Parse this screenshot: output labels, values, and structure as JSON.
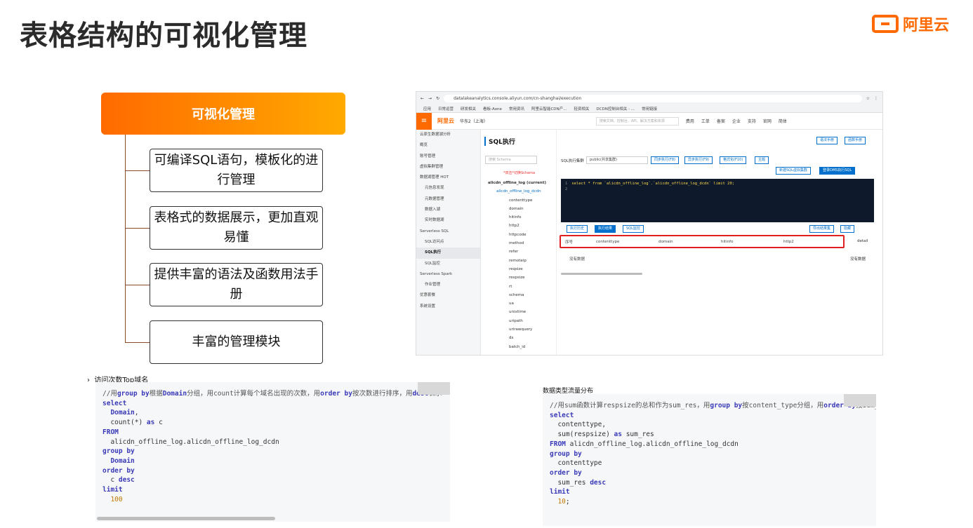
{
  "title": "表格结构的可视化管理",
  "logo_text": "阿里云",
  "mindmap": {
    "root": "可视化管理",
    "items": [
      "可编译SQL语句，模板化的进行管理",
      "表格式的数据展示，更加直观易懂",
      "提供丰富的语法及函数用法手册",
      "丰富的管理模块"
    ]
  },
  "console": {
    "url": "datalakeanalytics.console.aliyun.com/cn-shanghai/execution",
    "bookmarks": [
      "应用",
      "日常运营",
      "研发相关",
      "看板-Aone",
      "常用资讯",
      "阿里云智能CDN产...",
      "轻资相关",
      "DCDN控制台相关 - ...",
      "常用链接"
    ],
    "brand": "阿里云",
    "region": "华东2（上海）",
    "search_placeholder": "搜索文档、控制台、API、解决方案和资源",
    "nav_links": [
      "费用",
      "工单",
      "备案",
      "企业",
      "支持",
      "官网",
      "简体"
    ],
    "sidebar": [
      {
        "label": "云原生数据湖分析",
        "sub": false,
        "active": false
      },
      {
        "label": "概览",
        "sub": false,
        "active": false
      },
      {
        "label": "账号管理",
        "sub": false,
        "active": false
      },
      {
        "label": "虚拟集群管理",
        "sub": false,
        "active": false
      },
      {
        "label": "数据湖管理  HOT",
        "sub": false,
        "active": false
      },
      {
        "label": "元信息发现",
        "sub": true,
        "active": false
      },
      {
        "label": "元数据管理",
        "sub": true,
        "active": false
      },
      {
        "label": "数据入湖",
        "sub": true,
        "active": false
      },
      {
        "label": "实时数据湖",
        "sub": true,
        "active": false
      },
      {
        "label": "Serverless SQL",
        "sub": false,
        "active": false
      },
      {
        "label": "SQL访问点",
        "sub": true,
        "active": false
      },
      {
        "label": "SQL执行",
        "sub": true,
        "active": true
      },
      {
        "label": "SQL监控",
        "sub": true,
        "active": false
      },
      {
        "label": "Serverless Spark",
        "sub": false,
        "active": false
      },
      {
        "label": "作业管理",
        "sub": true,
        "active": false
      },
      {
        "label": "优惠套餐",
        "sub": false,
        "active": false
      },
      {
        "label": "系统设置",
        "sub": false,
        "active": false
      }
    ],
    "panel_title": "SQL执行",
    "schema_search": "搜索 Schema",
    "schema_hint": "*双击*切换Schema",
    "tree": [
      "alicdn_offline_log (current)",
      "alicdn_offline_log_dcdn",
      "contenttype",
      "domain",
      "hitinfo",
      "http2",
      "httpcode",
      "method",
      "refer",
      "remoteip",
      "reqsize",
      "respsize",
      "rt",
      "schema",
      "ua",
      "unixtime",
      "uripath",
      "urirawquery",
      "ds",
      "batch_id"
    ],
    "vc_label": "SQL执行集群",
    "vc_value": "public(共享集群)",
    "buttons": {
      "sync": "同步执行(F8)",
      "async": "异步执行(F9)",
      "format": "格式化(F10)",
      "theme": "主题",
      "new_vc": "新建SQL虚拟集群",
      "dms": "登录DMS执行SQL",
      "manual": "语法手册",
      "func": "函数手册",
      "export": "导出结果集",
      "hide": "隐藏"
    },
    "sql_text": "select * from `alicdn_offline_log`.`alicdn_offline_log_dcdn` limit 20;",
    "result_tabs": [
      "执行历史",
      "执行结果",
      "SQL监控"
    ],
    "columns": [
      "序号",
      "contenttype",
      "domain",
      "hitinfo",
      "http2"
    ],
    "detail": "detail",
    "no_data": "没有数据"
  },
  "code1": {
    "label": "访问次数Top域名"
  },
  "code2": {
    "label": "数据类型流量分布"
  }
}
